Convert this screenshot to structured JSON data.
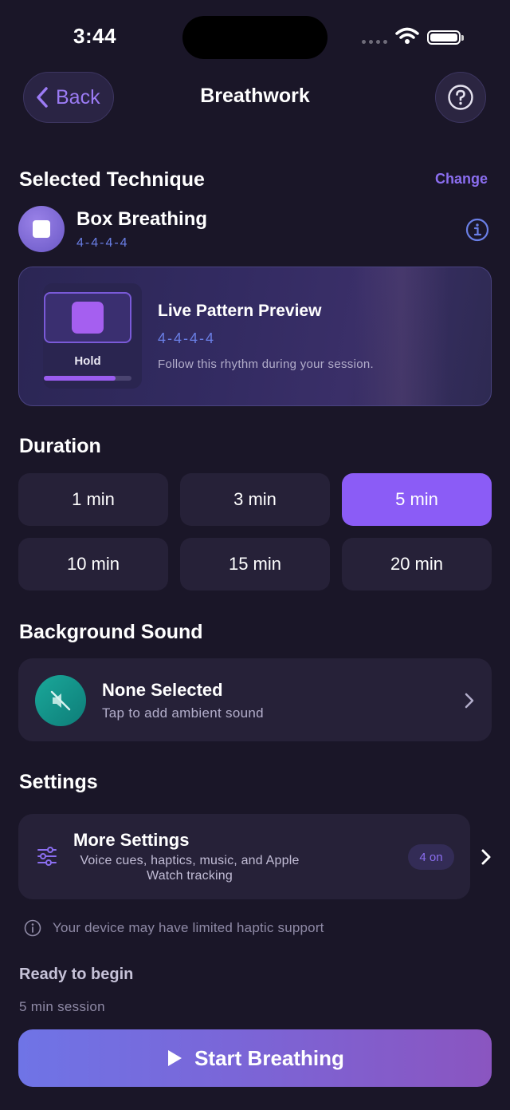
{
  "status_bar": {
    "time": "3:44"
  },
  "header": {
    "back_label": "Back",
    "title": "Breathwork"
  },
  "technique": {
    "section_title": "Selected Technique",
    "change_label": "Change",
    "name": "Box Breathing",
    "pattern": "4-4-4-4"
  },
  "preview": {
    "phase_label": "Hold",
    "phase_progress": 0.82,
    "title": "Live Pattern Preview",
    "pattern": "4-4-4-4",
    "subtitle": "Follow this rhythm during your session."
  },
  "duration": {
    "section_title": "Duration",
    "options": [
      "1 min",
      "3 min",
      "5 min",
      "10 min",
      "15 min",
      "20 min"
    ],
    "selected": "5 min"
  },
  "sound": {
    "section_title": "Background Sound",
    "title": "None Selected",
    "subtitle": "Tap to add ambient sound"
  },
  "settings": {
    "section_title": "Settings",
    "title": "More Settings",
    "subtitle": "Voice cues, haptics, music, and Apple Watch tracking",
    "badge": "4 on",
    "note": "Your device may have limited haptic support"
  },
  "footer": {
    "ready_title": "Ready to begin",
    "session_label": "5 min session",
    "start_label": "Start Breathing"
  },
  "colors": {
    "background": "#1a1628",
    "accent": "#8b5cf6",
    "card": "#262138",
    "link": "#8b6ef0"
  }
}
